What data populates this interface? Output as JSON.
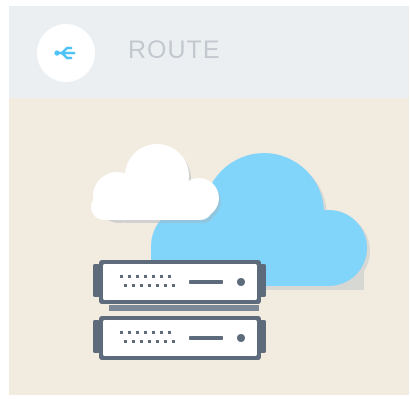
{
  "card": {
    "title": "ROUTE",
    "icon": "route-icon",
    "illustration": {
      "icons": [
        "cloud-icon",
        "cloud-icon",
        "server-rack-icon"
      ]
    }
  },
  "colors": {
    "header_bg": "#eceff2",
    "body_bg": "#f2ebe0",
    "title_text": "#c3c8ce",
    "accent": "#4fc3f7",
    "cloud_blue": "#81d4fa",
    "cloud_white": "#ffffff",
    "server_frame": "#5d6b7a"
  }
}
